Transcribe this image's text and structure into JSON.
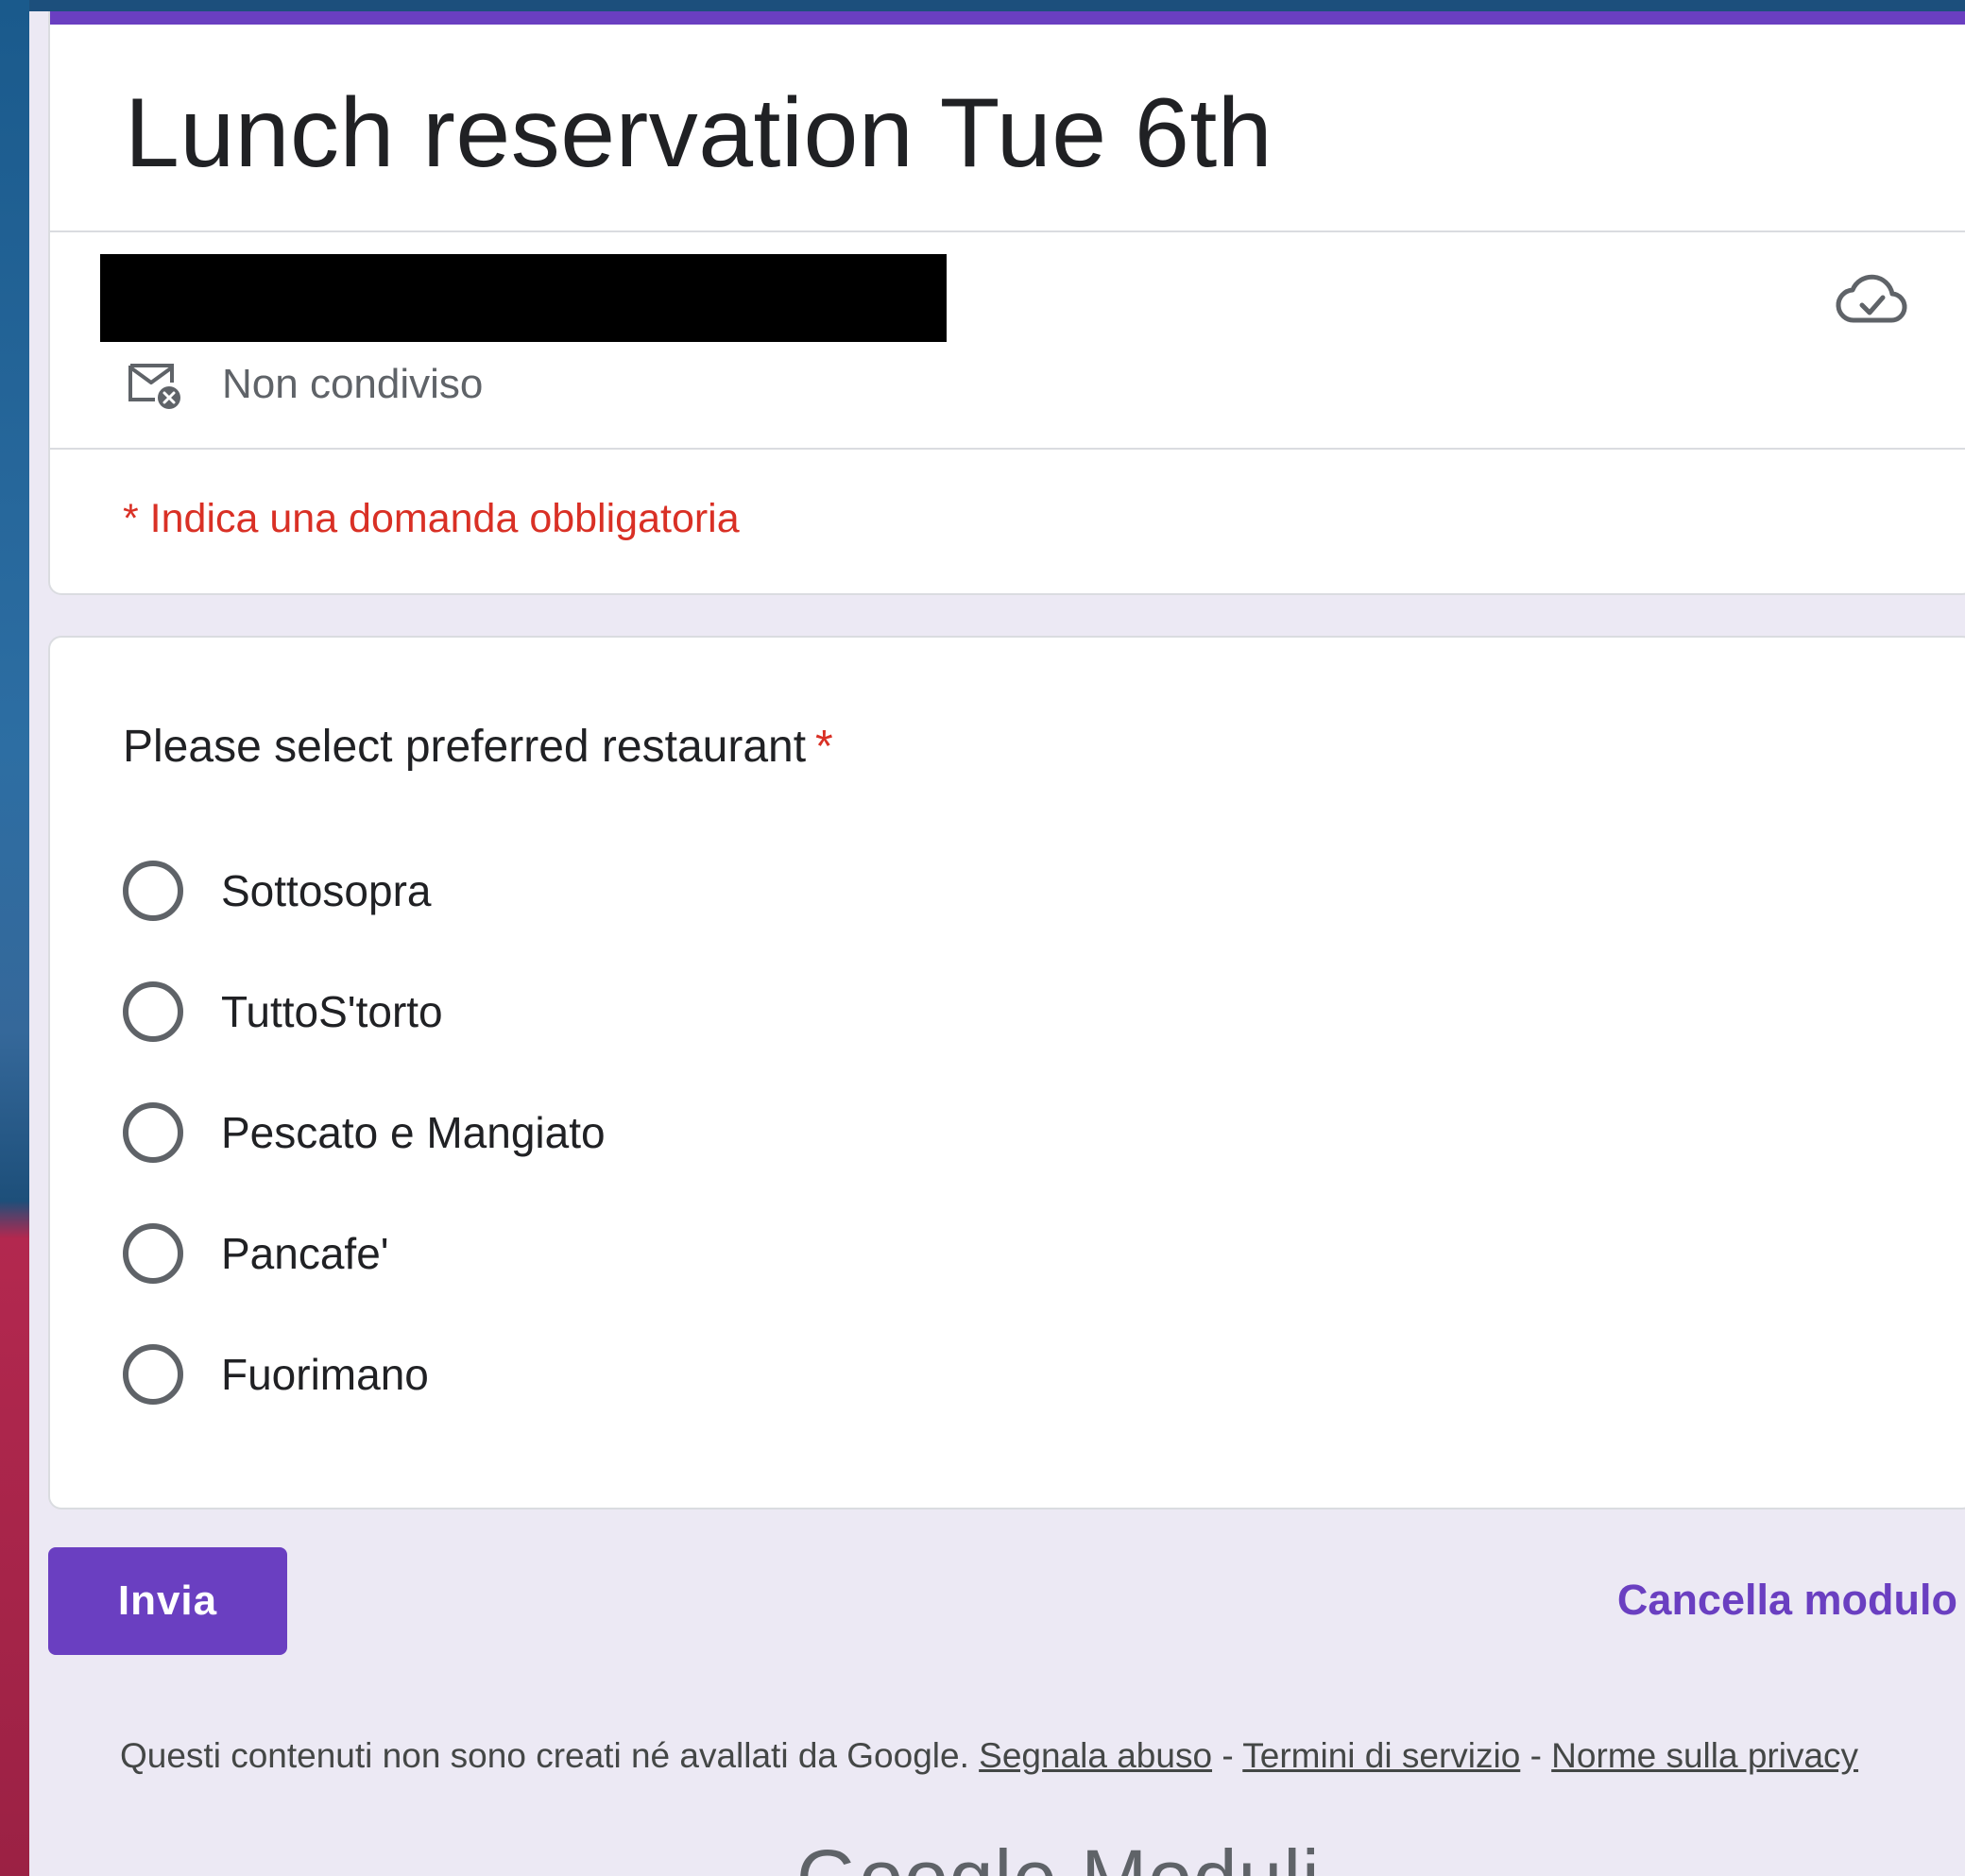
{
  "form": {
    "title": "Lunch reservation Tue 6th",
    "account_status": "Non condiviso",
    "required_note": "* Indica una domanda obbligatoria",
    "accent_color": "#6a3fc1"
  },
  "question": {
    "title": "Please select preferred restaurant",
    "required_marker": "*",
    "options": [
      "Sottosopra",
      "TuttoS'torto",
      "Pescato e Mangiato",
      "Pancafe'",
      "Fuorimano"
    ]
  },
  "actions": {
    "submit_label": "Invia",
    "clear_label": "Cancella modulo"
  },
  "footer": {
    "disclaimer": "Questi contenuti non sono creati né avallati da Google.",
    "report_abuse": "Segnala abuso",
    "terms": "Termini di servizio",
    "privacy": "Norme sulla privacy",
    "separator": "-",
    "brand": "Google Moduli"
  },
  "icons": {
    "cloud": "cloud-saved-icon",
    "mail": "mail-not-shared-icon"
  }
}
